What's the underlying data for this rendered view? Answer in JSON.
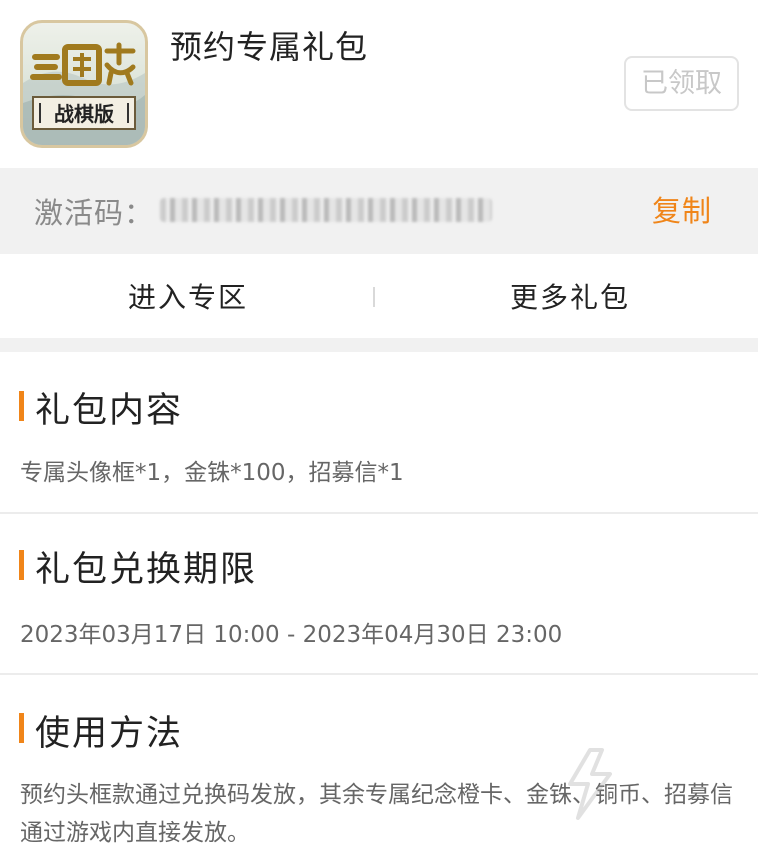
{
  "header": {
    "title": "预约专属礼包",
    "icon_name": "game-logo-icon",
    "claimed_label": "已领取"
  },
  "code": {
    "label": "激活码：",
    "value": "",
    "copy_label": "复制"
  },
  "links": {
    "zone_label": "进入专区",
    "more_label": "更多礼包"
  },
  "sections": {
    "contents": {
      "title": "礼包内容",
      "body": "专属头像框*1，金铢*100，招募信*1"
    },
    "period": {
      "title": "礼包兑换期限",
      "body": "2023年03月17日 10:00 - 2023年04月30日 23:00"
    },
    "usage": {
      "title": "使用方法",
      "body": "预约头框款通过兑换码发放，其余专属纪念橙卡、金铢、铜币、招募信通过游戏内直接发放。"
    }
  },
  "colors": {
    "accent": "#f08519",
    "gray_bg": "#f1f1f1",
    "claimed_text": "#c8c8c8"
  }
}
